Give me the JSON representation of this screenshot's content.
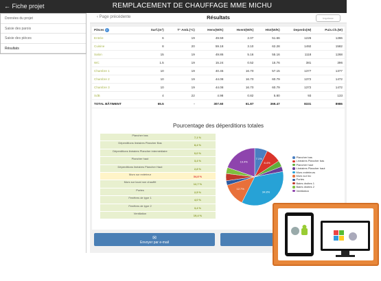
{
  "topbar": {
    "back_label": "← Fiche projet",
    "title": "REMPLACEMENT DE CHAUFFAGE MME MICHU"
  },
  "sidebar": {
    "items": [
      {
        "label": "Données du projet"
      },
      {
        "label": "Saisie des parois"
      },
      {
        "label": "Saisie des pièces"
      },
      {
        "label": "Résultats"
      }
    ]
  },
  "header": {
    "prev": "‹ Page précédente",
    "title": "Résultats",
    "print": "Imprimer"
  },
  "results": {
    "columns": [
      "Pièces",
      "Surf.(m²)",
      "T° Amb.(°C)",
      "Henv(W/K)",
      "Hvent(W/K)",
      "Htot(W/K)",
      "Deperds(W)",
      "Puis.Ch.(W)"
    ],
    "rows": [
      [
        "Entrée",
        "6",
        "19",
        "49.59",
        "2.07",
        "51.66",
        "1226",
        "1286"
      ],
      [
        "Cuisine",
        "8",
        "20",
        "59.18",
        "3.10",
        "62.28",
        "1492",
        "1582"
      ],
      [
        "Salon",
        "15",
        "19",
        "49.86",
        "5.16",
        "55.16",
        "1118",
        "1268"
      ],
      [
        "WC",
        "1.5",
        "19",
        "15.24",
        "0.52",
        "15.76",
        "381",
        "396"
      ],
      [
        "Chambre 1",
        "10",
        "19",
        "40.45",
        "16.70",
        "57.15",
        "1377",
        "1377"
      ],
      [
        "Chambre 2",
        "10",
        "19",
        "44.08",
        "16.70",
        "60.79",
        "1372",
        "1472"
      ],
      [
        "Chambre 3",
        "10",
        "19",
        "44.08",
        "16.70",
        "60.79",
        "1372",
        "1472"
      ],
      [
        "SdB",
        "4",
        "22",
        "4.98",
        "0.82",
        "5.80",
        "93",
        "133"
      ]
    ],
    "total": [
      "TOTAL BÂTIMENT",
      "65.5",
      "-",
      "307.60",
      "61.87",
      "369.47",
      "8331",
      "8986"
    ]
  },
  "pct": {
    "title": "Pourcentage des déperditions totales",
    "rows": [
      {
        "label": "Plancher bas",
        "value": "7,1 %"
      },
      {
        "label": "Déperditions linéaires Plancher Bas",
        "value": "8,4 %"
      },
      {
        "label": "Déperditions linéaires Plancher intermédiaire",
        "value": "0,0 %"
      },
      {
        "label": "Plancher haut",
        "value": "3,4 %"
      },
      {
        "label": "Déperditions linéaires Plancher Haut",
        "value": "2,8 %"
      },
      {
        "label": "Murs sur extérieur",
        "value": "34,8 %"
      },
      {
        "label": "Murs sur local non chauffé",
        "value": "12,7 %"
      },
      {
        "label": "Portes",
        "value": "2,5 %"
      },
      {
        "label": "Fenêtres de type 1",
        "value": "4,0 %"
      },
      {
        "label": "Fenêtres de type 2",
        "value": "3,4 %"
      },
      {
        "label": "Ventilation",
        "value": "19,4 %"
      }
    ]
  },
  "chart_data": {
    "type": "pie",
    "series": [
      {
        "name": "Plancher bas",
        "value": 7.1,
        "color": "#4a7fc1"
      },
      {
        "name": "Linéaires Plancher bas",
        "value": 8.4,
        "color": "#d9342b"
      },
      {
        "name": "Plancher haut",
        "value": 3.4,
        "color": "#5fae3a"
      },
      {
        "name": "Linéaires Plancher haut",
        "value": 2.8,
        "color": "#6a3d9a"
      },
      {
        "name": "Murs extérieurs",
        "value": 34.8,
        "color": "#27a2d6"
      },
      {
        "name": "Murs sur lnc",
        "value": 12.7,
        "color": "#e8703a"
      },
      {
        "name": "Portes",
        "value": 2.5,
        "color": "#2c5aa0"
      },
      {
        "name": "Baies droites 1",
        "value": 4.0,
        "color": "#c0392b"
      },
      {
        "name": "Baies droites 2",
        "value": 3.4,
        "color": "#7fbf3f"
      },
      {
        "name": "Ventilation",
        "value": 19.4,
        "color": "#8e44ad"
      }
    ],
    "labels_shown": [
      "7.1%",
      "8.4%",
      "34.8%",
      "12.7%",
      "19.4%"
    ]
  },
  "actions": {
    "email_label": "Envoyer par e-mail",
    "email_icon": "✉"
  }
}
